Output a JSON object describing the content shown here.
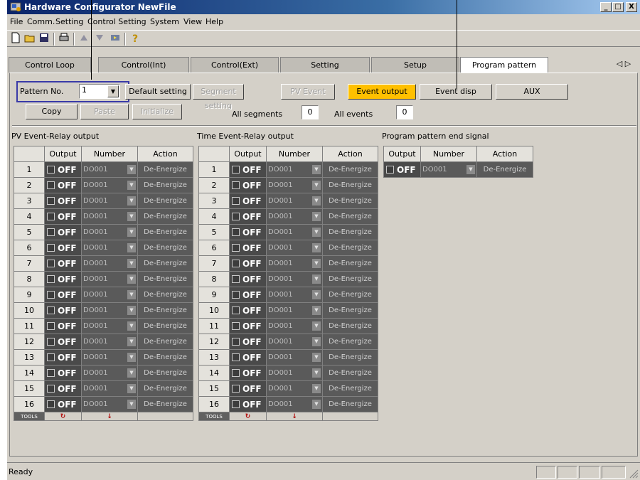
{
  "window": {
    "title": "Hardware Configurator NewFile",
    "minimize": "_",
    "maximize": "□",
    "close": "X"
  },
  "menu": [
    "File",
    "Comm.",
    "Setting",
    "Control Setting",
    "System",
    "View",
    "Help"
  ],
  "toolbar_icons": [
    "new-file-icon",
    "open-folder-icon",
    "save-icon",
    "print-icon",
    "comm-upload-icon",
    "comm-download-icon",
    "comm-settings-icon",
    "help-icon"
  ],
  "tabs": [
    "Control Loop",
    "Control(Int)",
    "Control(Ext)",
    "Setting",
    "Setup",
    "Program pattern"
  ],
  "active_tab": "Program pattern",
  "tab_scroll": "◁ ▷",
  "top_controls": {
    "pattern_no_label": "Pattern No.",
    "pattern_no_value": "1",
    "default_setting": "Default setting",
    "segment_setting": "Segment setting",
    "pv_event": "PV Event",
    "event_output": "Event output",
    "event_disp": "Event disp",
    "aux": "AUX",
    "copy": "Copy",
    "paste": "Paste",
    "initialize": "Initialize",
    "all_segments_label": "All segments",
    "all_segments_value": "0",
    "all_events_label": "All events",
    "all_events_value": "0"
  },
  "sections": {
    "pv_event": "PV Event-Relay output",
    "time_event": "Time Event-Relay output",
    "end_signal": "Program pattern end signal"
  },
  "columns": [
    "Output",
    "Number",
    "Action"
  ],
  "rows": [
    "1",
    "2",
    "3",
    "4",
    "5",
    "6",
    "7",
    "8",
    "9",
    "10",
    "11",
    "12",
    "13",
    "14",
    "15",
    "16"
  ],
  "cell": {
    "output": "OFF",
    "number": "DO001",
    "action": "De-Energize"
  },
  "tools_label": "TOOLS",
  "status": "Ready",
  "accent_color": "#ffc000"
}
